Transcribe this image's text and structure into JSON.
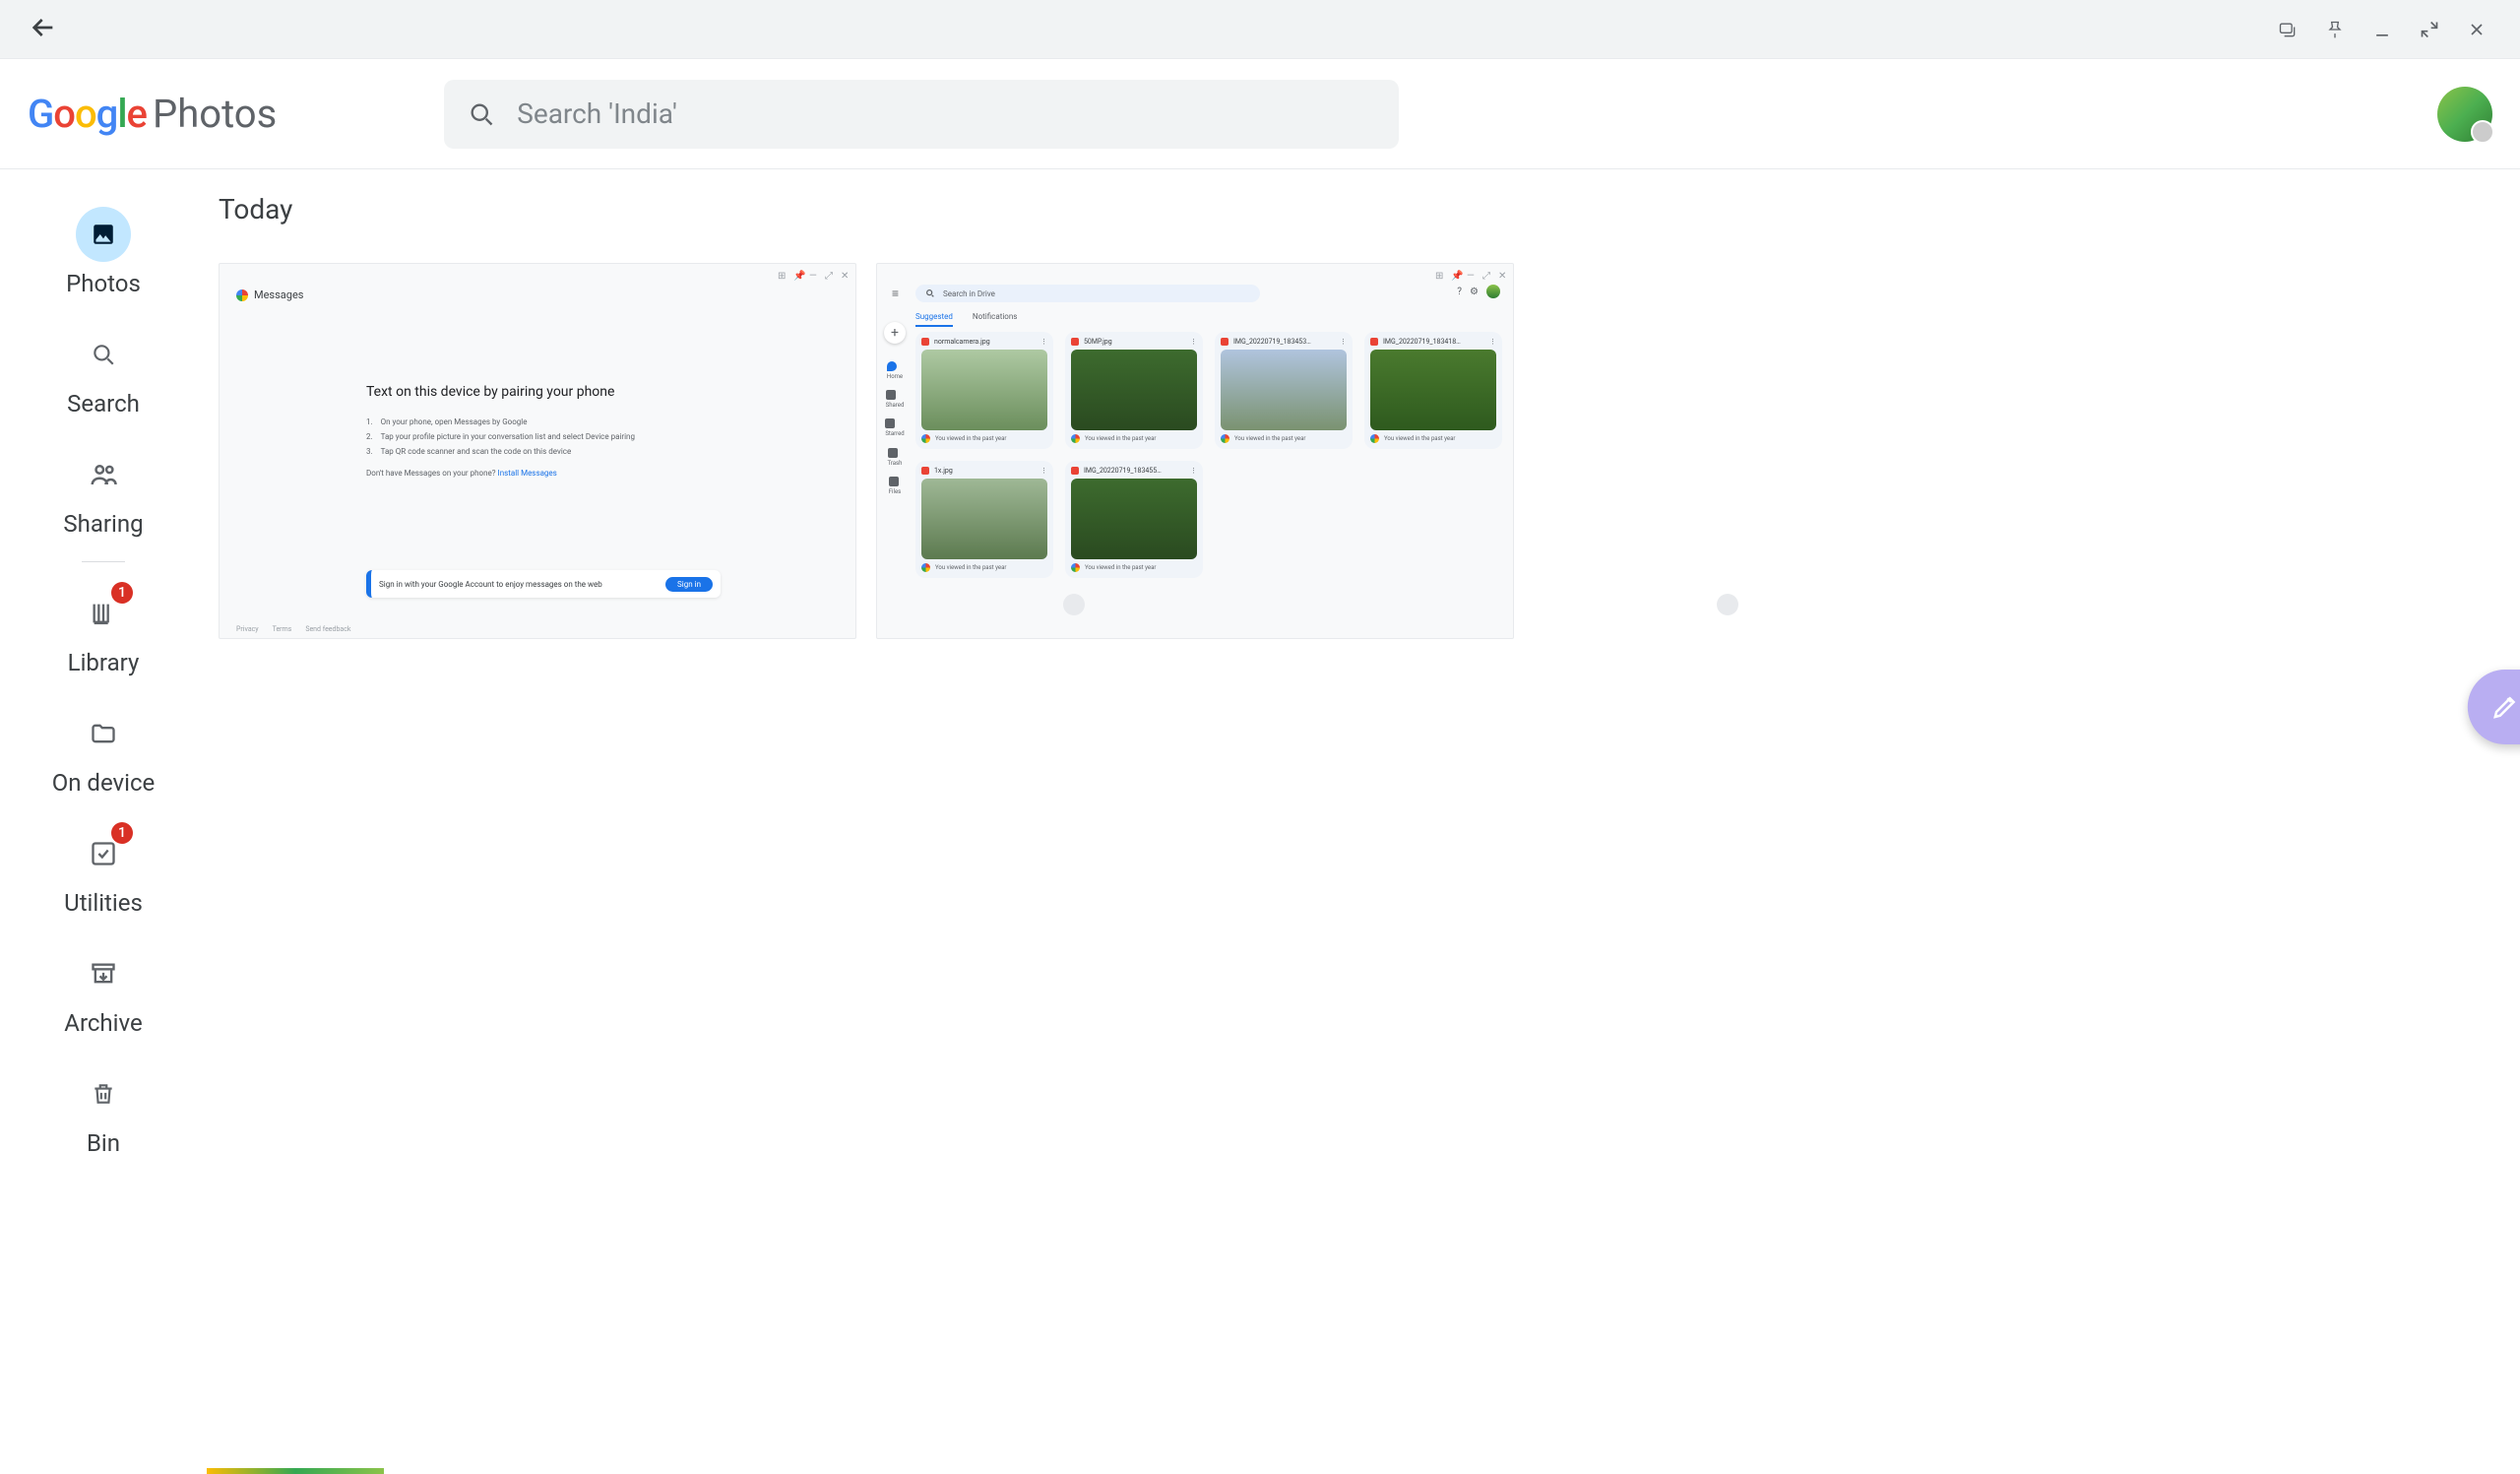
{
  "chrome": {
    "back": "Back"
  },
  "header": {
    "app_name": "Photos",
    "search_placeholder": "Search 'India'"
  },
  "sidebar": {
    "photos": "Photos",
    "search": "Search",
    "sharing": "Sharing",
    "library": "Library",
    "library_badge": "1",
    "on_device": "On device",
    "utilities": "Utilities",
    "utilities_badge": "1",
    "archive": "Archive",
    "bin": "Bin"
  },
  "main": {
    "section_title": "Today"
  },
  "thumb1": {
    "brand": "Messages",
    "title": "Text on this device by pairing your phone",
    "step1": "On your phone, open      Messages by Google",
    "step2": "Tap your profile picture in your conversation list and select Device pairing",
    "step3": "Tap QR code scanner and scan the code on this device",
    "nomsg": "Don't have Messages on your phone?",
    "install": "Install Messages",
    "signin_text": "Sign in with your Google Account to enjoy messages on the web",
    "signin_btn": "Sign in",
    "footer1": "Privacy",
    "footer2": "Terms",
    "footer3": "Send feedback"
  },
  "thumb2": {
    "search_placeholder": "Search in Drive",
    "tab_suggested": "Suggested",
    "tab_notifications": "Notifications",
    "side": {
      "home": "Home",
      "shared": "Shared",
      "starred": "Starred",
      "trash": "Trash",
      "files": "Files"
    },
    "files": [
      {
        "name": "normalcamera.jpg",
        "meta": "You viewed in the past year"
      },
      {
        "name": "50MP.jpg",
        "meta": "You viewed in the past year"
      },
      {
        "name": "IMG_20220719_183453…",
        "meta": "You viewed in the past year"
      },
      {
        "name": "IMG_20220719_183418…",
        "meta": "You viewed in the past year"
      },
      {
        "name": "1x.jpg",
        "meta": "You viewed in the past year"
      },
      {
        "name": "IMG_20220719_183455…",
        "meta": "You viewed in the past year"
      }
    ]
  }
}
